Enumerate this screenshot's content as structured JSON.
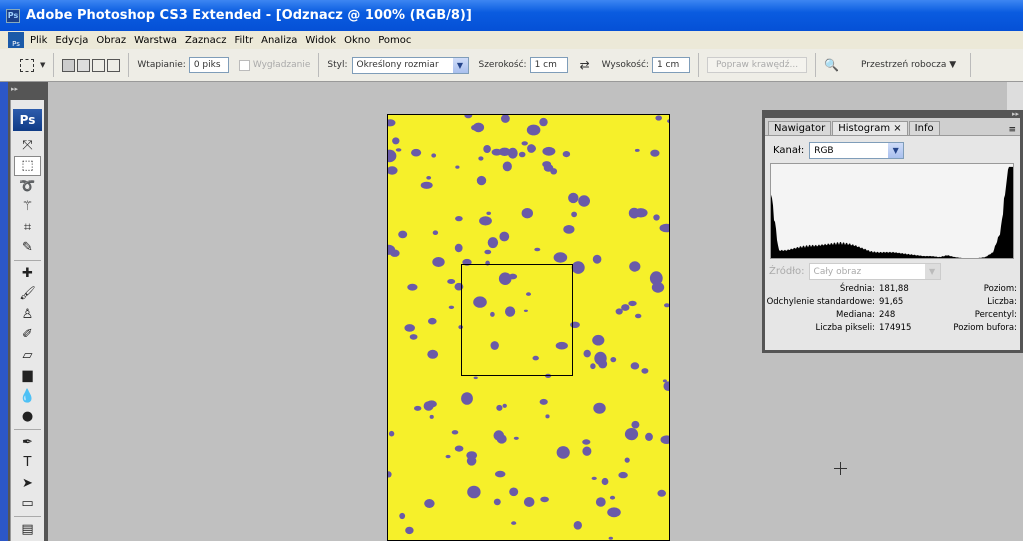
{
  "window": {
    "title": "Adobe Photoshop CS3 Extended - [Odznacz @ 100% (RGB/8)]",
    "app_icon": "Ps"
  },
  "menu": [
    "Plik",
    "Edycja",
    "Obraz",
    "Warstwa",
    "Zaznacz",
    "Filtr",
    "Analiza",
    "Widok",
    "Okno",
    "Pomoc"
  ],
  "options": {
    "feather_label": "Wtapianie:",
    "feather_value": "0 piks",
    "antialias_label": "Wygładzanie",
    "style_label": "Styl:",
    "style_value": "Określony rozmiar",
    "width_label": "Szerokość:",
    "width_value": "1 cm",
    "height_label": "Wysokość:",
    "height_value": "1 cm",
    "refine_edge": "Popraw krawędź...",
    "workspace": "Przestrzeń robocza ▼"
  },
  "toolbox": {
    "logo": "Ps",
    "tools": [
      "move",
      "rect-marquee",
      "lasso",
      "magic-wand",
      "crop",
      "slice",
      "healing-brush",
      "brush",
      "clone-stamp",
      "history-brush",
      "eraser",
      "gradient",
      "blur",
      "dodge",
      "pen",
      "type",
      "path-select",
      "shape",
      "notes"
    ],
    "selected": "rect-marquee"
  },
  "panel": {
    "tabs": [
      "Nawigator",
      "Histogram",
      "Info"
    ],
    "active_tab": "Histogram",
    "channel_label": "Kanał:",
    "channel_value": "RGB",
    "source_label": "Źródło:",
    "source_value": "Cały obraz",
    "stats": [
      {
        "label": "Średnia:",
        "value": "181,88",
        "right": "Poziom:"
      },
      {
        "label": "Odchylenie standardowe:",
        "value": "91,65",
        "right": "Liczba:"
      },
      {
        "label": "Mediana:",
        "value": "248",
        "right": "Percentyl:"
      },
      {
        "label": "Liczba pikseli:",
        "value": "174915",
        "right": "Poziom bufora:"
      }
    ],
    "histogram": {
      "levels": [
        0,
        8,
        16,
        24,
        32,
        40,
        48,
        56,
        64,
        72,
        80,
        88,
        96,
        104,
        112,
        120,
        128,
        136,
        144,
        152,
        160,
        168,
        176,
        184,
        192,
        200,
        208,
        216,
        224,
        232,
        240,
        248,
        255
      ],
      "heights": [
        0.7,
        0.1,
        0.1,
        0.12,
        0.14,
        0.15,
        0.15,
        0.16,
        0.17,
        0.18,
        0.17,
        0.15,
        0.12,
        0.09,
        0.08,
        0.08,
        0.08,
        0.07,
        0.06,
        0.05,
        0.04,
        0.04,
        0.03,
        0.05,
        0.03,
        0.02,
        0.02,
        0.02,
        0.03,
        0.08,
        0.3,
        1.0,
        1.0
      ]
    }
  },
  "colors": {
    "image_bg": "#f6f02a",
    "spots": "#6a5aa8",
    "titlebar": "#0a5ce0"
  }
}
